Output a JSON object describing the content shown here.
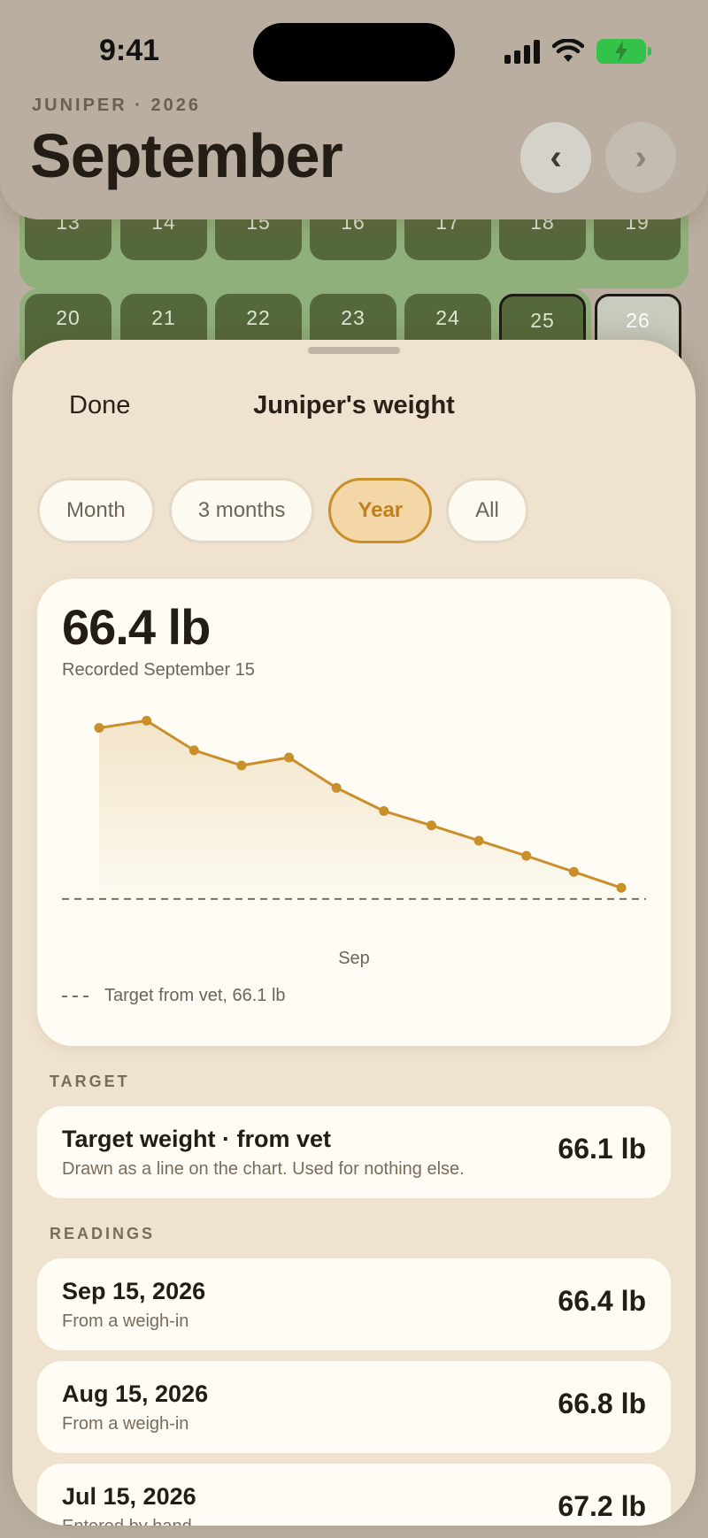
{
  "status": {
    "time": "9:41"
  },
  "header": {
    "eyebrow": "JUNIPER · 2026",
    "title": "September",
    "prev_glyph": "‹",
    "next_glyph": "›"
  },
  "calendar": {
    "week1": [
      "13",
      "14",
      "15",
      "16",
      "17",
      "18",
      "19"
    ],
    "week2": [
      "20",
      "21",
      "22",
      "23",
      "24",
      "25",
      "26"
    ]
  },
  "sheet": {
    "done_label": "Done",
    "title": "Juniper's weight",
    "segments": [
      "Month",
      "3 months",
      "Year",
      "All"
    ],
    "selected_segment": "Year"
  },
  "chart_card": {
    "current_value": "66.4 lb",
    "recorded_label": "Recorded September 15",
    "legend_label": "Target from vet, 66.1 lb"
  },
  "chart_data": {
    "type": "area",
    "x_labels": [
      "Sep"
    ],
    "values": [
      68.24,
      68.33,
      67.96,
      67.77,
      67.87,
      67.49,
      67.2,
      67.02,
      66.83,
      66.64,
      66.44,
      66.24
    ],
    "ylim": [
      65.9,
      68.6
    ],
    "target": 66.1,
    "grid": false,
    "accent_color": "#c88f2a",
    "target_line_color": "#7b7060"
  },
  "target_section": {
    "label": "TARGET",
    "title": "Target weight · from vet",
    "subtitle": "Drawn as a line on the chart. Used for nothing else.",
    "value": "66.1 lb"
  },
  "readings_section": {
    "label": "READINGS",
    "items": [
      {
        "date": "Sep 15, 2026",
        "source": "From a weigh-in",
        "value": "66.4 lb"
      },
      {
        "date": "Aug 15, 2026",
        "source": "From a weigh-in",
        "value": "66.8 lb"
      },
      {
        "date": "Jul 15, 2026",
        "source": "Entered by hand",
        "value": "67.2 lb"
      }
    ]
  }
}
